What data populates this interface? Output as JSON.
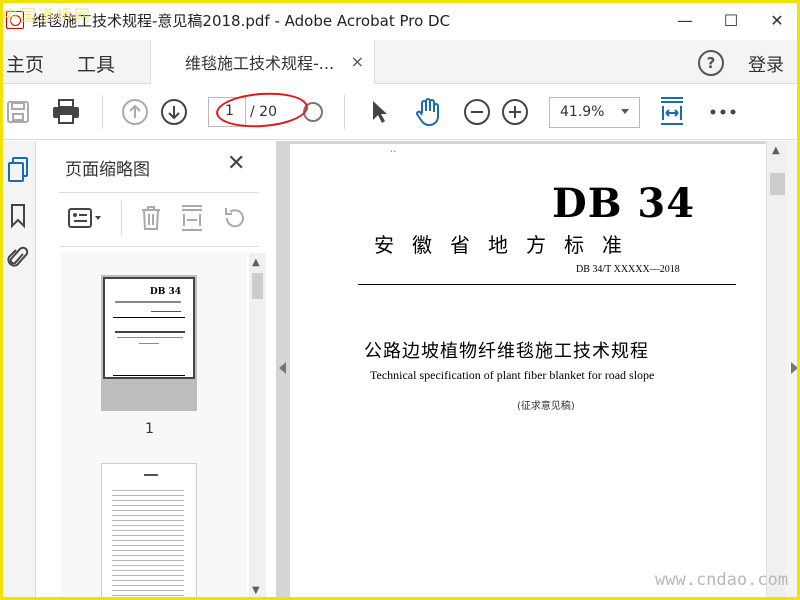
{
  "window": {
    "title": "维毯施工技术规程-意见稿2018.pdf - Adobe Acrobat Pro DC",
    "minimize": "—",
    "maximize": "☐",
    "close": "✕"
  },
  "menu": {
    "home": "主页",
    "tools": "工具",
    "tab_label": "维毯施工技术规程-...",
    "tab_close": "×",
    "help": "?",
    "login": "登录"
  },
  "toolbar": {
    "current_page": "1",
    "total_pages": "/ 20",
    "zoom": "41.9%",
    "icons": [
      "save-icon",
      "print-icon",
      "page-up-icon",
      "page-down-icon",
      "select-cursor-icon",
      "hand-tool-icon",
      "zoom-out-icon",
      "zoom-in-icon",
      "fit-page-icon",
      "more-icon"
    ],
    "accent_color": "#1c6bb0"
  },
  "sidebar": {
    "panel_title": "页面缩略图",
    "close": "✕",
    "thumbnails": [
      {
        "label": "1",
        "db": "DB 34"
      },
      {
        "label": ""
      }
    ]
  },
  "document": {
    "db_code": "DB 34",
    "standard_name": "安徽省地方标准",
    "std_number": "DB 34/T XXXXX—2018",
    "title_cn": "公路边坡植物纤维毯施工技术规程",
    "title_en": "Technical specification of plant fiber blanket for road slope",
    "draft_note": "(征求意见稿)"
  },
  "watermarks": {
    "top_left": "中国道桥网",
    "bottom_right": "www.cndao.com"
  },
  "colors": {
    "frame": "#f2e200",
    "annotation": "#e01a1a"
  }
}
